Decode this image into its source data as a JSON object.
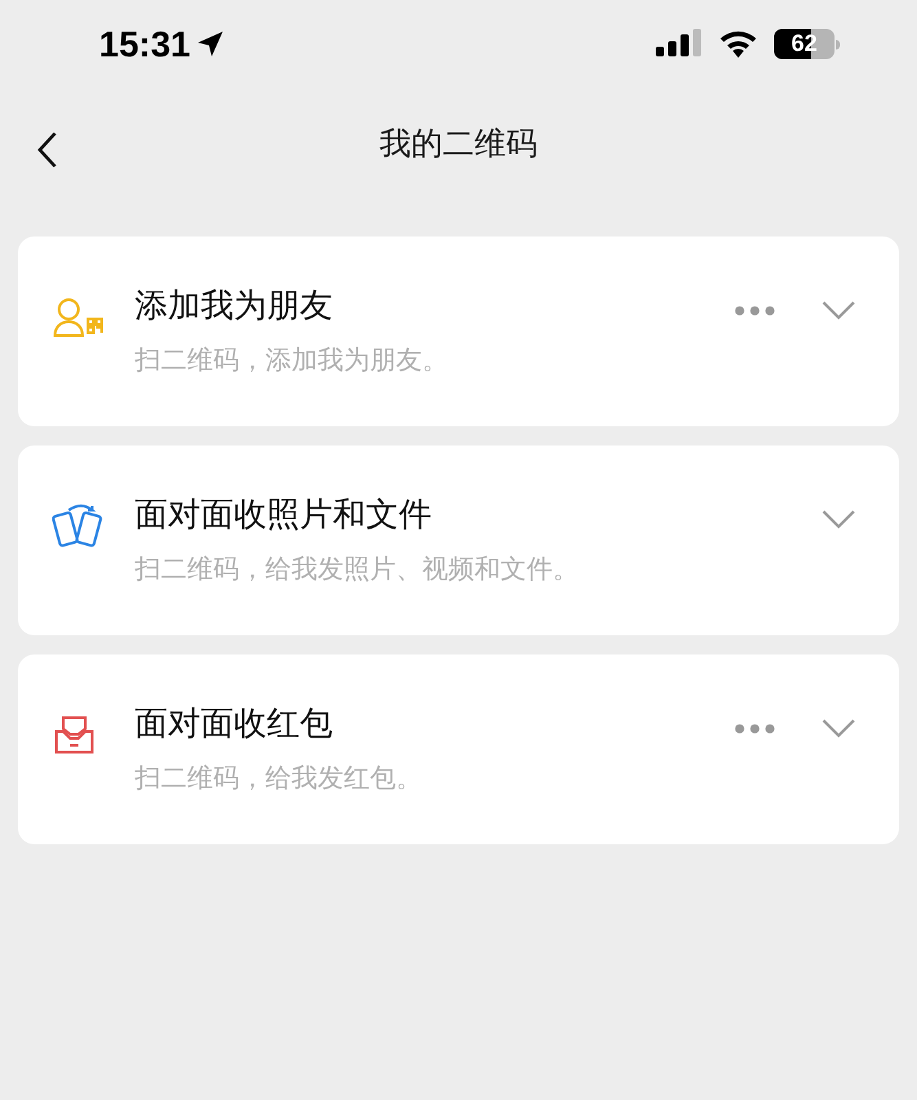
{
  "status_bar": {
    "time": "15:31",
    "battery": "62"
  },
  "header": {
    "title": "我的二维码"
  },
  "cards": [
    {
      "kind": "friend",
      "title": "添加我为朋友",
      "subtitle": "扫二维码，添加我为朋友。",
      "more": true
    },
    {
      "kind": "files",
      "title": "面对面收照片和文件",
      "subtitle": "扫二维码，给我发照片、视频和文件。",
      "more": false
    },
    {
      "kind": "redpacket",
      "title": "面对面收红包",
      "subtitle": "扫二维码，给我发红包。",
      "more": true
    }
  ]
}
